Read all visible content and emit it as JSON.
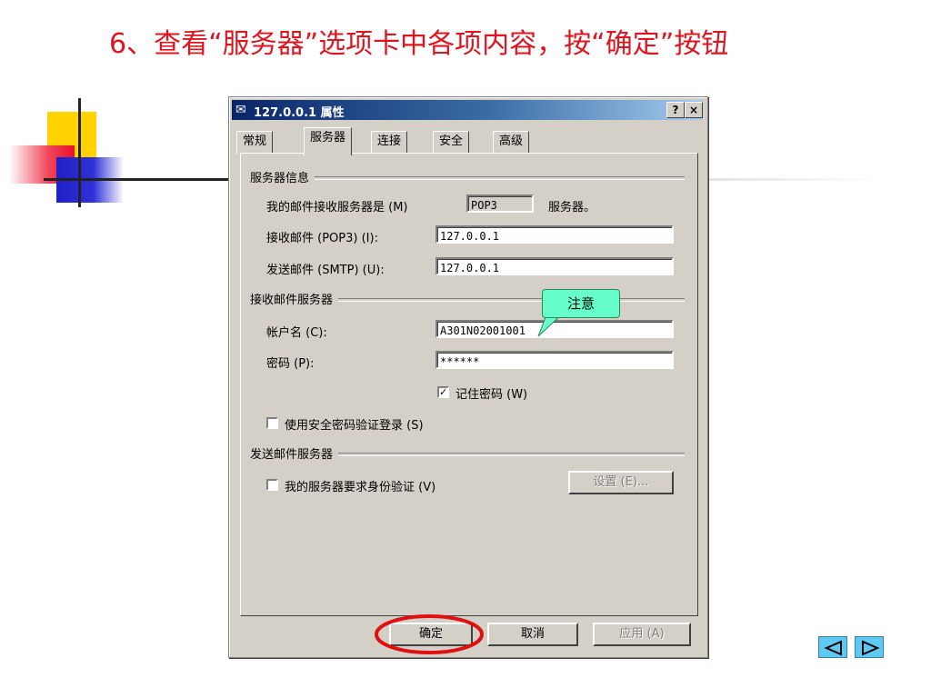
{
  "slide": {
    "title": "6、查看“服务器”选项卡中各项内容，按“确定”按钮"
  },
  "dialog": {
    "title": "127.0.0.1 属性",
    "help_btn": "?",
    "close_btn": "×",
    "tabs": [
      {
        "label": "常规",
        "active": false
      },
      {
        "label": "服务器",
        "active": true
      },
      {
        "label": "连接",
        "active": false
      },
      {
        "label": "安全",
        "active": false
      },
      {
        "label": "高级",
        "active": false
      }
    ],
    "server_info": {
      "group_label": "服务器信息",
      "incoming_type_label": "我的邮件接收服务器是 (M)",
      "incoming_type_value": "POP3",
      "incoming_type_suffix": "服务器。",
      "pop3_label": "接收邮件 (POP3) (I):",
      "pop3_value": "127.0.0.1",
      "smtp_label": "发送邮件 (SMTP) (U):",
      "smtp_value": "127.0.0.1"
    },
    "incoming_server": {
      "group_label": "接收邮件服务器",
      "account_label": "帐户名 (C):",
      "account_value": "A301N02001001",
      "password_label": "密码 (P):",
      "password_value": "******",
      "remember_label": "记住密码 (W)",
      "remember_checked": true,
      "spa_label": "使用安全密码验证登录 (S)",
      "spa_checked": false
    },
    "outgoing_server": {
      "group_label": "发送邮件服务器",
      "auth_label": "我的服务器要求身份验证 (V)",
      "auth_checked": false,
      "settings_btn": "设置 (E)..."
    },
    "buttons": {
      "ok": "确定",
      "cancel": "取消",
      "apply": "应用 (A)"
    }
  },
  "callout": {
    "text": "注意"
  },
  "colors": {
    "title_red": "#e0141e",
    "titlebar_blue": "#0a246a",
    "callout_green": "#66ffcc",
    "highlight_ring": "#e01010",
    "nav_blue": "#5ec9f2"
  },
  "nav": {
    "prev_icon": "triangle-left-icon",
    "next_icon": "triangle-right-icon"
  }
}
